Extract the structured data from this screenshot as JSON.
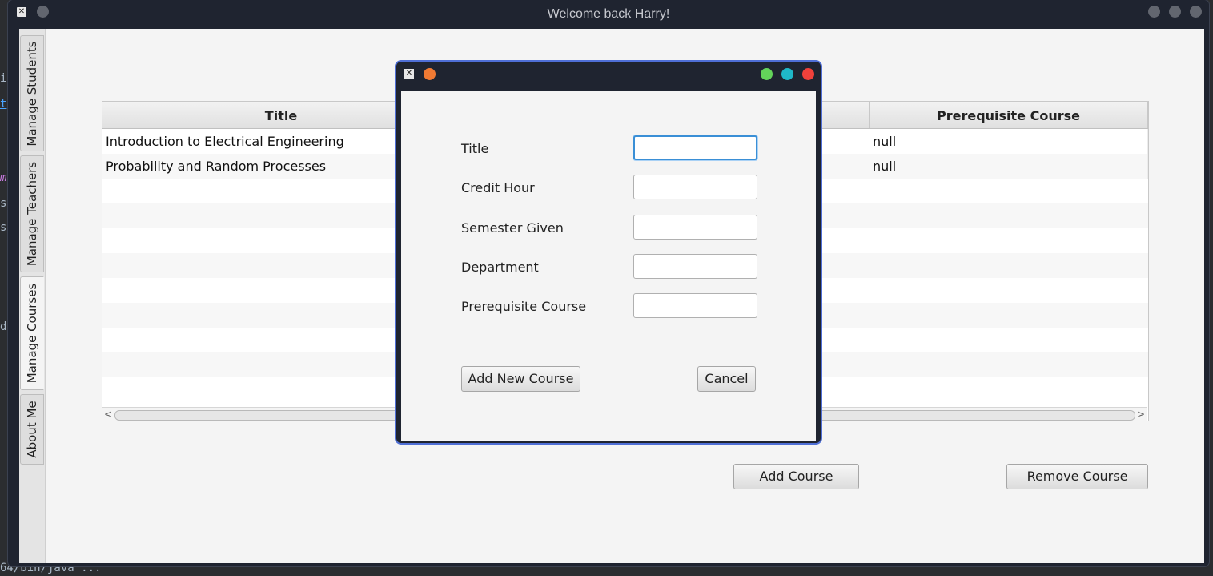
{
  "window": {
    "title": "Welcome back Harry!"
  },
  "tabs": [
    {
      "label": "Manage Students"
    },
    {
      "label": "Manage Teachers"
    },
    {
      "label": "Manage Courses"
    },
    {
      "label": "About Me"
    }
  ],
  "table": {
    "columns": [
      "Title",
      "Prerequisite Course"
    ],
    "rows": [
      {
        "title": "Introduction to Electrical Engineering",
        "prerequisite": "null"
      },
      {
        "title": "Probability and Random Processes",
        "prerequisite": "null"
      }
    ]
  },
  "actions": {
    "add_course": "Add Course",
    "remove_course": "Remove Course"
  },
  "dialog": {
    "fields": [
      {
        "label": "Title",
        "value": ""
      },
      {
        "label": "Credit Hour",
        "value": ""
      },
      {
        "label": "Semester Given",
        "value": ""
      },
      {
        "label": "Department",
        "value": ""
      },
      {
        "label": "Prerequisite Course",
        "value": ""
      }
    ],
    "add_button": "Add New Course",
    "cancel_button": "Cancel",
    "dot_colors": [
      "#f07a33",
      "#63d35a",
      "#1fb8c8",
      "#f0413b"
    ]
  },
  "background": {
    "ide_fragments": [
      "i",
      "t",
      "m",
      "s",
      "s",
      "d"
    ],
    "ide_bottom_text": "64/bin/java ..."
  }
}
